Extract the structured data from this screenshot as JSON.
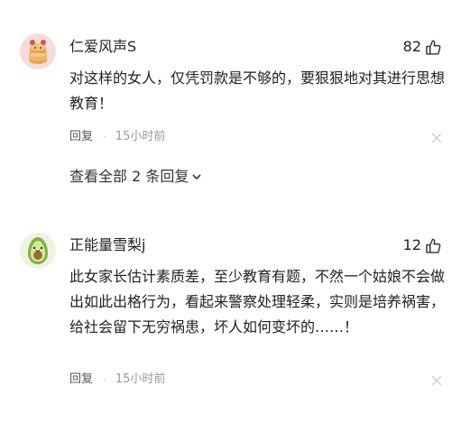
{
  "comments": [
    {
      "avatar_icon": "cookie-stack-avatar",
      "username": "仁爱风声S",
      "like_count": "82",
      "like_icon": "thumbs-up-icon",
      "text": "对这样的女人，仅凭罚款是不够的，要狠狠地对其进行思想教育！",
      "reply_label": "回复",
      "separator": "·",
      "time": "15小时前",
      "close_icon": "close-icon",
      "view_replies_label": "查看全部 2 条回复",
      "chevron_icon": "chevron-down-icon"
    },
    {
      "avatar_icon": "avocado-avatar",
      "username": "正能量雪梨j",
      "like_count": "12",
      "like_icon": "thumbs-up-icon",
      "text": "此女家长估计素质差，至少教育有题，不然一个姑娘不会做出如此出格行为，看起来警察处理轻柔，实则是培养祸害，给社会留下无穷祸患，坏人如何变坏的……！",
      "reply_label": "回复",
      "separator": "·",
      "time": "15小时前",
      "close_icon": "close-icon"
    }
  ],
  "colors": {
    "text_primary": "#222222",
    "text_secondary": "#999999",
    "avatar1_bg": "#f6dcd9",
    "avatar2_bg": "#eef2e2",
    "avocado_green": "#7bb342",
    "avocado_seed": "#a0673a"
  }
}
